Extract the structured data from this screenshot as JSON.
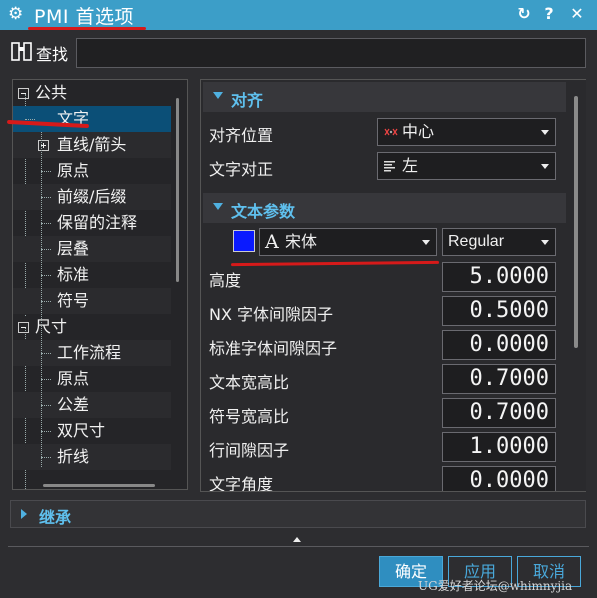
{
  "window": {
    "title": "PMI 首选项",
    "icons": [
      "gear-icon",
      "reset-icon",
      "help-icon",
      "close-icon"
    ]
  },
  "find": {
    "label": "查找",
    "value": ""
  },
  "tree": {
    "items": [
      {
        "label": "公共",
        "expander": "minus"
      },
      {
        "label": "文字",
        "selected": true
      },
      {
        "label": "直线/箭头",
        "expander": "plus"
      },
      {
        "label": "原点"
      },
      {
        "label": "前缀/后缀"
      },
      {
        "label": "保留的注释"
      },
      {
        "label": "层叠"
      },
      {
        "label": "标准"
      },
      {
        "label": "符号"
      },
      {
        "label": "尺寸",
        "expander": "minus"
      },
      {
        "label": "工作流程"
      },
      {
        "label": "原点"
      },
      {
        "label": "公差"
      },
      {
        "label": "双尺寸"
      },
      {
        "label": "折线"
      }
    ]
  },
  "alignment": {
    "header": "对齐",
    "position_label": "对齐位置",
    "position_value": "中心",
    "justify_label": "文字对正",
    "justify_value": "左"
  },
  "text_params": {
    "header": "文本参数",
    "font_color": "#0a1aff",
    "font_prefix": "A",
    "font_value": "宋体",
    "style_value": "Regular",
    "rows": [
      {
        "label": "高度",
        "value": "5.0000"
      },
      {
        "label": "NX 字体间隙因子",
        "value": "0.5000"
      },
      {
        "label": "标准字体间隙因子",
        "value": "0.0000"
      },
      {
        "label": "文本宽高比",
        "value": "0.7000"
      },
      {
        "label": "符号宽高比",
        "value": "0.7000"
      },
      {
        "label": "行间隙因子",
        "value": "1.0000"
      },
      {
        "label": "文字角度",
        "value": "0.0000"
      }
    ]
  },
  "inherit": {
    "header": "继承"
  },
  "buttons": {
    "ok": "确定",
    "apply": "应用",
    "cancel": "取消"
  },
  "watermark": "UG爱好者论坛@whimnyjia",
  "colors": {
    "titlebar": "#3c9ec8",
    "accent": "#5fc0ee",
    "selected": "#0b4f77",
    "annotation": "#d61a1a"
  }
}
